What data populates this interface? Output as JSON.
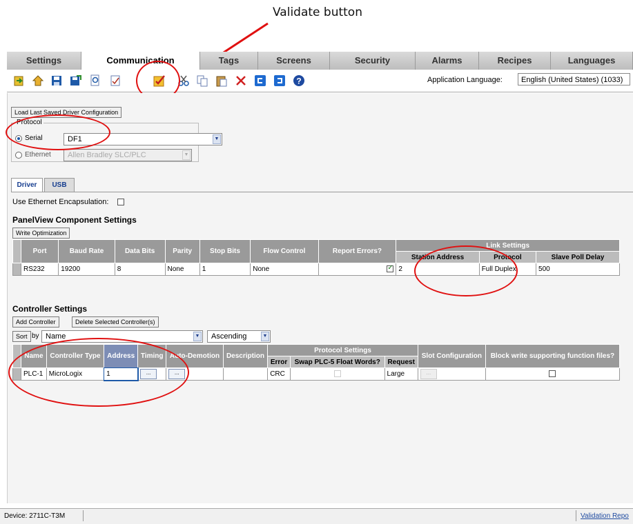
{
  "callout": {
    "label": "Validate button"
  },
  "tabs": [
    "Settings",
    "Communication",
    "Tags",
    "Screens",
    "Security",
    "Alarms",
    "Recipes",
    "Languages"
  ],
  "active_tab": "Communication",
  "toolbar": {
    "app_language_label": "Application Language:",
    "app_language_value": "English (United States) (1033)"
  },
  "load_button": "Load Last Saved Driver Configuration",
  "protocol": {
    "legend": "Protocol",
    "serial_label": "Serial",
    "serial_value": "DF1",
    "ethernet_label": "Ethernet",
    "ethernet_value": "Allen Bradley SLC/PLC"
  },
  "subtabs": [
    "Driver",
    "USB"
  ],
  "use_ethernet_encapsulation": "Use Ethernet Encapsulation:",
  "panelview": {
    "heading": "PanelView Component Settings",
    "write_opt_button": "Write Optimization",
    "headers": [
      "Port",
      "Baud Rate",
      "Data Bits",
      "Parity",
      "Stop Bits",
      "Flow Control",
      "Report Errors?"
    ],
    "link_group": "Link Settings",
    "link_headers": [
      "Station Address",
      "Protocol",
      "Slave Poll Delay"
    ],
    "row": {
      "port": "RS232",
      "baud": "19200",
      "data_bits": "8",
      "parity": "None",
      "stop_bits": "1",
      "flow": "None",
      "station": "2",
      "protocol": "Full Duplex",
      "poll_delay": "500"
    }
  },
  "controller": {
    "heading": "Controller Settings",
    "add_button": "Add Controller",
    "delete_button": "Delete Selected Controller(s)",
    "sort_button": "Sort",
    "by_label": "by",
    "sort_field": "Name",
    "sort_order": "Ascending",
    "headers": [
      "Name",
      "Controller Type",
      "Address",
      "Timing",
      "Auto-Demotion",
      "Description"
    ],
    "protocol_group": "Protocol Settings",
    "protocol_headers": [
      "Error",
      "Swap PLC-5 Float Words?",
      "Request"
    ],
    "slot_header": "Slot Configuration",
    "block_header": "Block write supporting function files?",
    "row": {
      "name": "PLC-1",
      "type": "MicroLogix",
      "address": "1",
      "error": "CRC",
      "request": "Large",
      "ellipsis": "..."
    }
  },
  "status": {
    "device": "Device:  2711C-T3M",
    "validation": "Validation Repo"
  },
  "colors": {
    "annotation": "#e01010",
    "header_gray": "#9a9a9a"
  }
}
